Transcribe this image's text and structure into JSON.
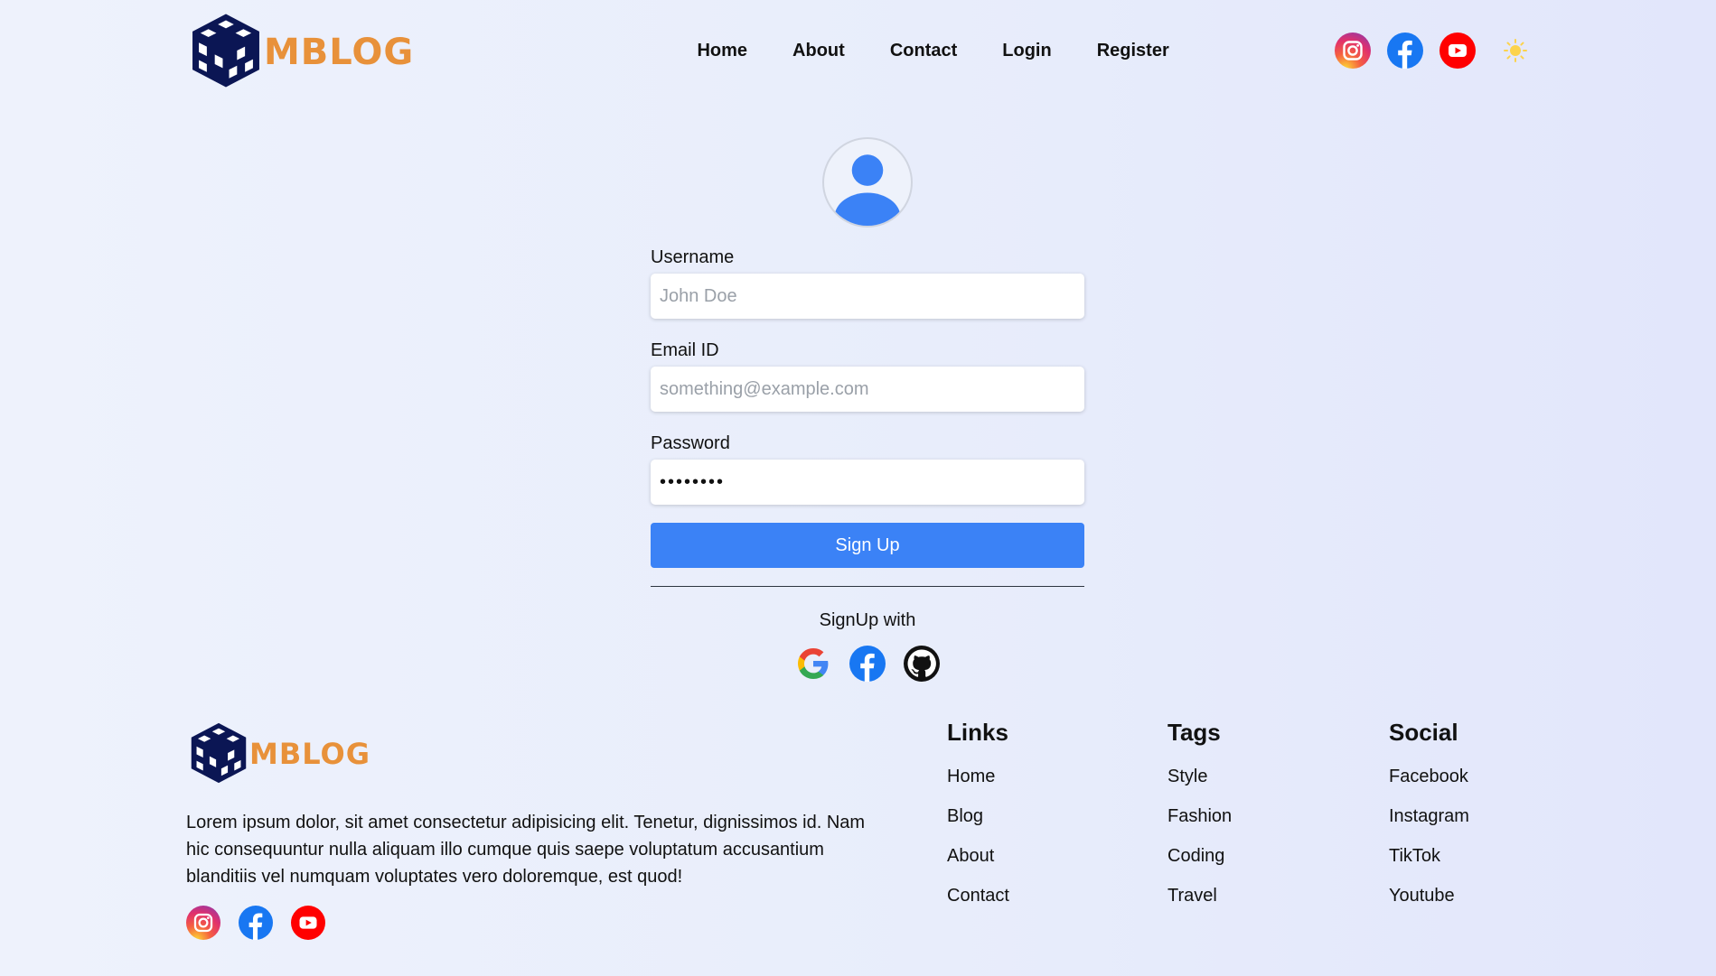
{
  "brand": {
    "name": "MBLOG",
    "accent": "#e8913a",
    "cube_color": "#0b1654"
  },
  "nav": {
    "items": [
      {
        "label": "Home"
      },
      {
        "label": "About"
      },
      {
        "label": "Contact"
      },
      {
        "label": "Login"
      },
      {
        "label": "Register"
      }
    ]
  },
  "header_socials": [
    "instagram-icon",
    "facebook-icon",
    "youtube-icon"
  ],
  "theme_toggle_icon": "sun-icon",
  "form": {
    "username_label": "Username",
    "username_placeholder": "John Doe",
    "email_label": "Email ID",
    "email_placeholder": "something@example.com",
    "password_label": "Password",
    "password_value": "••••••••",
    "submit_label": "Sign Up",
    "signup_with": "SignUp with",
    "oauth_icons": [
      "google-icon",
      "facebook-icon",
      "github-icon"
    ],
    "button_color": "#3b82f6"
  },
  "footer": {
    "about": "Lorem ipsum dolor, sit amet consectetur adipisicing elit. Tenetur, dignissimos id. Nam hic consequuntur nulla aliquam illo cumque quis saepe voluptatum accusantium blanditiis vel numquam voluptates vero doloremque, est quod!",
    "columns": [
      {
        "title": "Links",
        "items": [
          "Home",
          "Blog",
          "About",
          "Contact"
        ]
      },
      {
        "title": "Tags",
        "items": [
          "Style",
          "Fashion",
          "Coding",
          "Travel"
        ]
      },
      {
        "title": "Social",
        "items": [
          "Facebook",
          "Instagram",
          "TikTok",
          "Youtube"
        ]
      }
    ]
  }
}
